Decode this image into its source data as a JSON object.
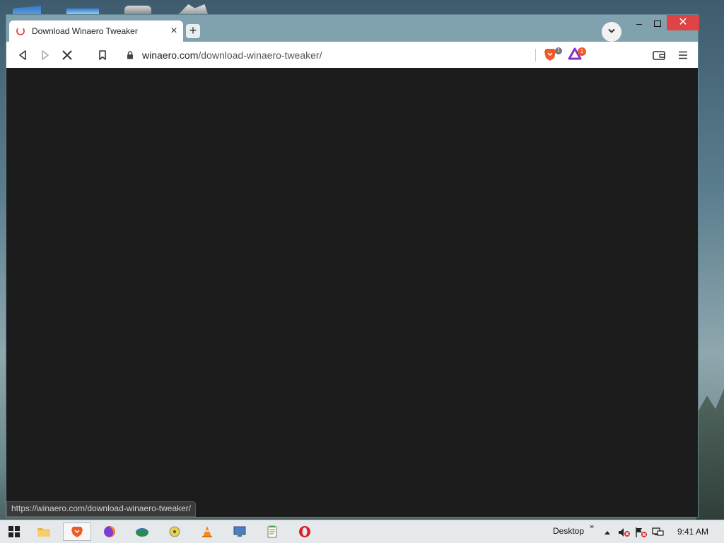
{
  "browser": {
    "tab": {
      "title": "Download Winaero Tweaker",
      "close_label": "×"
    },
    "new_tab_label": "+",
    "window_controls": {
      "close": "✕"
    },
    "address": {
      "domain": "winaero.com",
      "path": "/download-winaero-tweaker/"
    },
    "shield_count": "1",
    "rewards_count": "1",
    "status_url": "https://winaero.com/download-winaero-tweaker/"
  },
  "taskbar": {
    "desktop_label": "Desktop",
    "chevron": "»",
    "time": "9:41 AM"
  },
  "colors": {
    "window_frame": "#7fa2ae",
    "content_bg": "#1c1c1c",
    "close_red": "#e04343",
    "accent_orange": "#f05a28"
  }
}
